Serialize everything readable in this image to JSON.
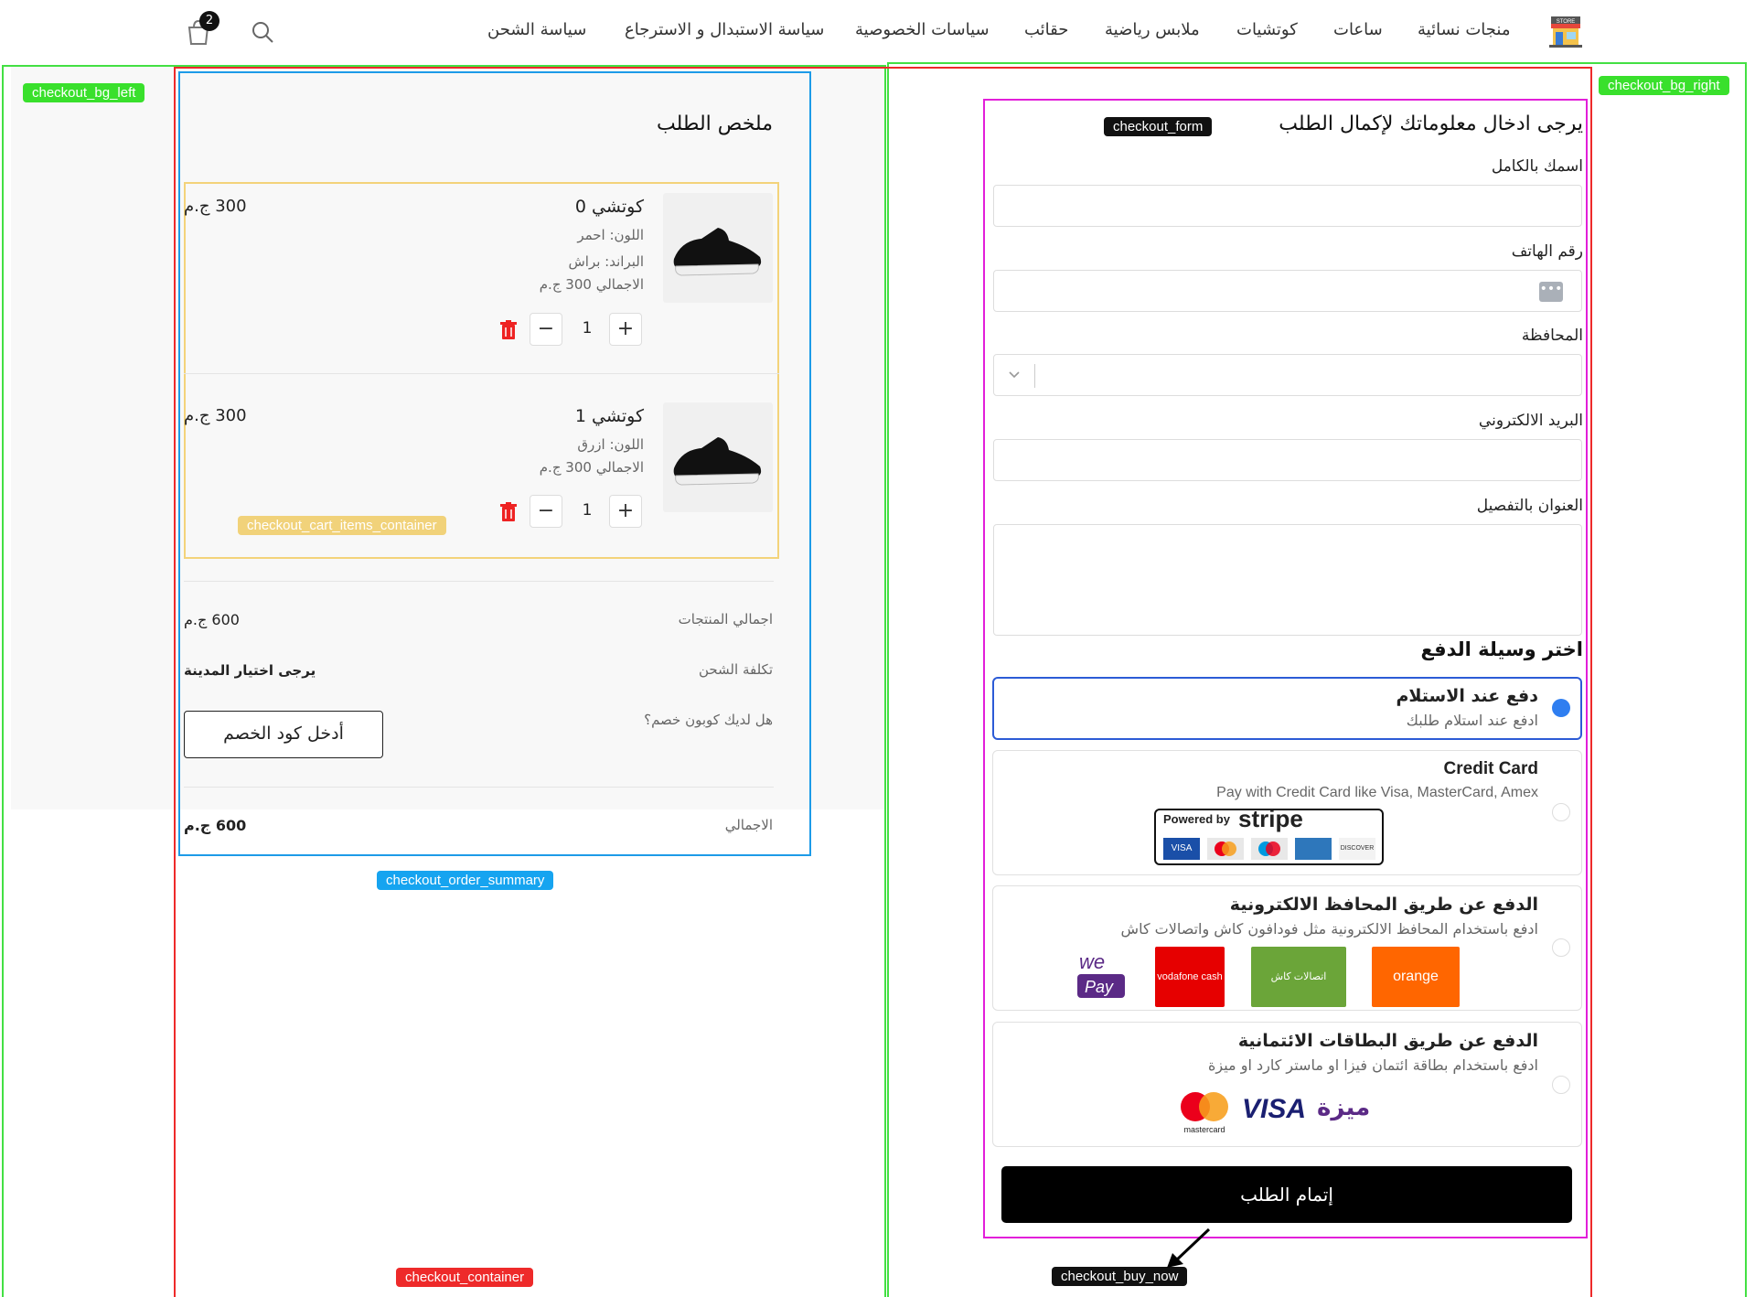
{
  "header": {
    "nav": [
      "منجات نسائية",
      "ساعات",
      "كوتشيات",
      "ملابس رياضية",
      "حقائب",
      "سياسات الخصوصية",
      "سياسة الاستبدال و الاسترجاع",
      "سياسة الشحن"
    ],
    "cart_count": "2",
    "icons": {
      "logo": "store-logo-icon",
      "search": "search-icon",
      "cart": "shopping-bag-icon"
    }
  },
  "annotations": {
    "bg_left": "checkout_bg_left",
    "bg_right": "checkout_bg_right",
    "form": "checkout_form",
    "cart_items": "checkout_cart_items_container",
    "order_summary": "checkout_order_summary",
    "container": "checkout_container",
    "buy_now": "checkout_buy_now"
  },
  "summary": {
    "title": "ملخص الطلب",
    "items": [
      {
        "name": "كوتشي 0",
        "price": "300 ج.م",
        "color": "اللون: احمر",
        "brand": "البراند: براش",
        "total": "الاجمالي 300 ج.م",
        "qty": "1"
      },
      {
        "name": "كوتشي 1",
        "price": "300 ج.م",
        "color": "اللون: ازرق",
        "total": "الاجمالي 300 ج.م",
        "qty": "1"
      }
    ],
    "products_total_label": "اجمالي المنتجات",
    "products_total_value": "600 ج.م",
    "shipping_label": "تكلفة الشحن",
    "shipping_value": "يرجى اختيار المدينة",
    "coupon_question": "هل لديك كوبون خصم؟",
    "coupon_button": "أدخل كود الخصم",
    "grand_total_label": "الاجمالي",
    "grand_total_value": "600 ج.م"
  },
  "form": {
    "title": "يرجى ادخال معلوماتك لإكمال الطلب",
    "name_label": "اسمك بالكامل",
    "phone_label": "رقم الهاتف",
    "governorate_label": "المحافظة",
    "email_label": "البريد الالكتروني",
    "address_label": "العنوان بالتفصيل",
    "payment_title": "اختر وسيلة الدفع",
    "payments": [
      {
        "title": "دفع عند الاستلام",
        "desc": "ادفع عند استلام طلبك"
      },
      {
        "title": "Credit Card",
        "desc": "Pay with Credit Card like Visa, MasterCard, Amex"
      },
      {
        "title": "الدفع عن طريق المحافظ الالكترونية",
        "desc": "ادفع باستخدام المحافظ الالكترونية مثل فودافون كاش واتصالات كاش"
      },
      {
        "title": "الدفع عن طريق البطاقات الائتمانية",
        "desc": "ادفع باستخدام بطاقة ائتمان فيزا او ماستر كارد او ميزة"
      }
    ],
    "stripe": {
      "powered": "Powered by",
      "brand": "stripe",
      "cards": [
        "VISA",
        "MasterCard",
        "Maestro",
        "AMERICAN EXPRESS",
        "DISCOVER"
      ]
    },
    "wallets": [
      "we Pay",
      "vodafone cash",
      "محفظة اتصالات كاش",
      "محفظة اورنج كاش orange"
    ],
    "cards": [
      "mastercard",
      "VISA",
      "ميزة"
    ],
    "buy_button": "إتمام الطلب"
  },
  "colors": {
    "accent": "#2f7ef0",
    "green_box": "#43e043",
    "red_box": "#ee2a2a",
    "blue_box": "#1d9be8",
    "pink_box": "#e21fd9",
    "yellow_box": "#f3d37a"
  }
}
